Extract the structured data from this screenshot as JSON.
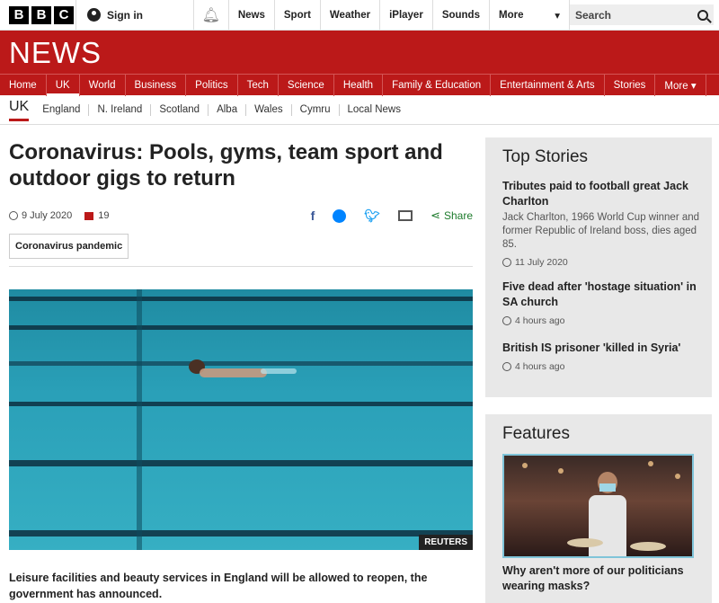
{
  "topbar": {
    "logo_letters": [
      "B",
      "B",
      "C"
    ],
    "signin": "Sign in",
    "nav": [
      "News",
      "Sport",
      "Weather",
      "iPlayer",
      "Sounds"
    ],
    "more": "More",
    "search_placeholder": "Search"
  },
  "news_wordmark": "NEWS",
  "mainnav": {
    "tabs": [
      "Home",
      "UK",
      "World",
      "Business",
      "Politics",
      "Tech",
      "Science",
      "Health",
      "Family & Education",
      "Entertainment & Arts",
      "Stories",
      "More ▾"
    ],
    "active": "UK"
  },
  "subnav": {
    "current": "UK",
    "regions": [
      "England",
      "N. Ireland",
      "Scotland",
      "Alba",
      "Wales",
      "Cymru",
      "Local News"
    ]
  },
  "article": {
    "headline": "Coronavirus: Pools, gyms, team sport and outdoor gigs to return",
    "date": "9 July 2020",
    "comments": "19",
    "share_label": "Share",
    "tag": "Coronavirus pandemic",
    "image_credit": "REUTERS",
    "summary": "Leisure facilities and beauty services in England will be allowed to reopen, the government has announced."
  },
  "sidebar": {
    "top_stories": {
      "heading": "Top Stories",
      "stories": [
        {
          "title": "Tributes paid to football great Jack Charlton",
          "desc": "Jack Charlton, 1966 World Cup winner and former Republic of Ireland boss, dies aged 85.",
          "time": "11 July 2020"
        },
        {
          "title": "Five dead after 'hostage situation' in SA church",
          "desc": "",
          "time": "4 hours ago"
        },
        {
          "title": "British IS prisoner 'killed in Syria'",
          "desc": "",
          "time": "4 hours ago"
        }
      ]
    },
    "features": {
      "heading": "Features",
      "title": "Why aren't more of our politicians wearing masks?"
    }
  },
  "colors": {
    "bbc_red": "#bb1919",
    "share_green": "#1d7b2c"
  }
}
